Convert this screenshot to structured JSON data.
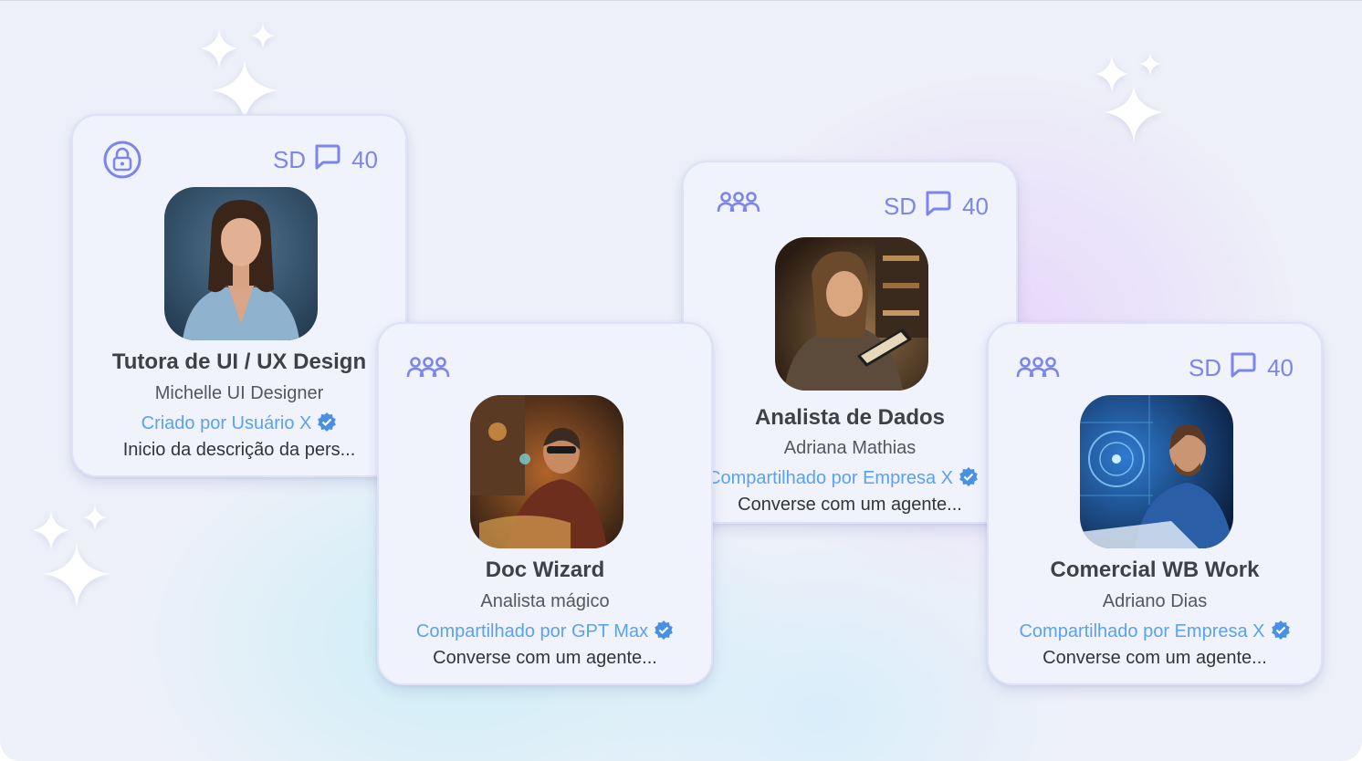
{
  "cards": [
    {
      "visibility_icon": "lock-icon",
      "stats": {
        "label": "SD",
        "icon": "chat-icon",
        "count": "40"
      },
      "name": "Tutora de UI / UX Design",
      "subtitle": "Michelle UI Designer",
      "creator": "Criado por Usuário X",
      "description": "Inicio da descrição da pers..."
    },
    {
      "visibility_icon": "group-icon",
      "stats": null,
      "name": "Doc Wizard",
      "subtitle": "Analista mágico",
      "creator": "Compartilhado por GPT Max",
      "description": "Converse com um agente..."
    },
    {
      "visibility_icon": "group-icon",
      "stats": {
        "label": "SD",
        "icon": "chat-icon",
        "count": "40"
      },
      "name": "Analista de Dados",
      "subtitle": "Adriana Mathias",
      "creator": "Compartilhado por Empresa X",
      "description": "Converse com um agente..."
    },
    {
      "visibility_icon": "group-icon",
      "stats": {
        "label": "SD",
        "icon": "chat-icon",
        "count": "40"
      },
      "name": "Comercial WB Work",
      "subtitle": "Adriano Dias",
      "creator": "Compartilhado por Empresa X",
      "description": "Converse com um agente..."
    }
  ],
  "colors": {
    "accent": "#7c86ea",
    "link": "#5aa2f0",
    "card_bg": "#f0f2fc",
    "verified": "#4a90e2"
  }
}
